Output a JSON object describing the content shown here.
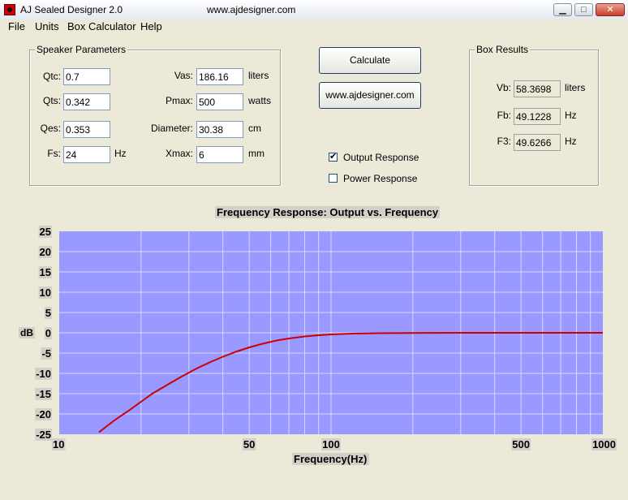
{
  "window": {
    "title": "AJ Sealed Designer 2.0",
    "url": "www.ajdesigner.com",
    "minimize": "▁",
    "maximize": "□",
    "close": "✕"
  },
  "menu": [
    "File",
    "Units",
    "Box Calculator",
    "Help"
  ],
  "speaker": {
    "title": "Speaker Parameters",
    "qtc": {
      "label": "Qtc:",
      "value": "0.7"
    },
    "qts": {
      "label": "Qts:",
      "value": "0.342"
    },
    "qes": {
      "label": "Qes:",
      "value": "0.353"
    },
    "fs": {
      "label": "Fs:",
      "value": "24",
      "unit": "Hz"
    },
    "vas": {
      "label": "Vas:",
      "value": "186.16",
      "unit": "liters"
    },
    "pmax": {
      "label": "Pmax:",
      "value": "500",
      "unit": "watts"
    },
    "diameter": {
      "label": "Diameter:",
      "value": "30.38",
      "unit": "cm"
    },
    "xmax": {
      "label": "Xmax:",
      "value": "6",
      "unit": "mm"
    }
  },
  "buttons": {
    "calculate": "Calculate",
    "website": "www.ajdesigner.com"
  },
  "options": {
    "output_response": {
      "label": "Output Response",
      "checked": true,
      "mark": "✔"
    },
    "power_response": {
      "label": "Power Response",
      "checked": false
    }
  },
  "results": {
    "title": "Box Results",
    "vb": {
      "label": "Vb:",
      "value": "58.3698",
      "unit": "liters"
    },
    "fb": {
      "label": "Fb:",
      "value": "49.1228",
      "unit": "Hz"
    },
    "f3": {
      "label": "F3:",
      "value": "49.6266",
      "unit": "Hz"
    }
  },
  "colors": {
    "plot_bg": "#9999ff",
    "grid": "#d8d8ff",
    "curve": "#cc0000",
    "label_bg": "#d4d0c8"
  },
  "chart_data": {
    "type": "line",
    "title": "Frequency Response: Output vs. Frequency",
    "xlabel": "Frequency(Hz)",
    "ylabel": "dB",
    "xscale": "log",
    "xlim": [
      10,
      1000
    ],
    "ylim": [
      -25,
      25
    ],
    "x_tick_labels": [
      10,
      50,
      100,
      500,
      1000
    ],
    "y_tick_labels": [
      25,
      20,
      15,
      10,
      5,
      0,
      -5,
      -10,
      -15,
      -20,
      -25
    ],
    "grid": true,
    "series": [
      {
        "x": [
          14,
          16,
          18,
          20,
          22,
          25,
          28,
          32,
          36,
          40,
          45,
          50,
          56,
          63,
          70,
          80,
          90,
          100,
          120,
          150,
          200,
          300,
          500,
          1000
        ],
        "y": [
          -24.5,
          -21.5,
          -19.2,
          -17,
          -15,
          -12.8,
          -10.9,
          -8.8,
          -7.2,
          -5.9,
          -4.6,
          -3.6,
          -2.7,
          -1.9,
          -1.4,
          -0.9,
          -0.6,
          -0.4,
          -0.2,
          -0.1,
          -0.05,
          0,
          0,
          0
        ]
      }
    ]
  }
}
